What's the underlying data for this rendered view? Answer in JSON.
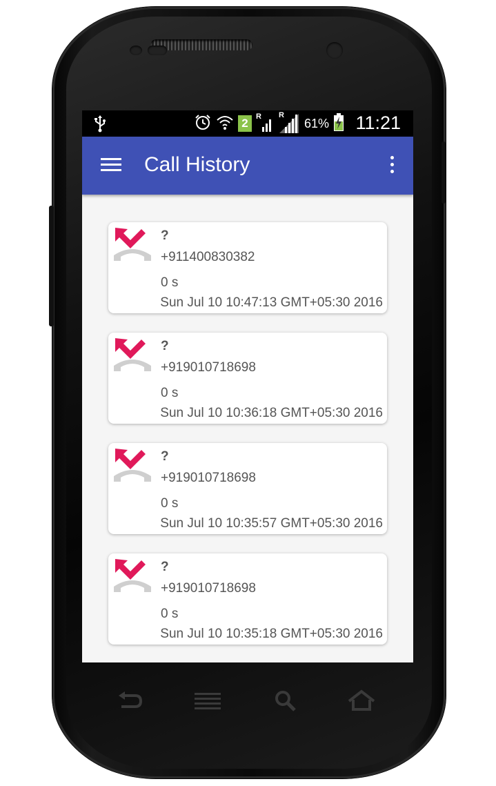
{
  "status_bar": {
    "usb_icon": "usb-icon",
    "alarm_icon": "alarm-clock-icon",
    "wifi_icon": "wifi-icon",
    "sim_badge": "2",
    "roaming_label": "R",
    "battery_percent": "61%",
    "time": "11:21"
  },
  "app_bar": {
    "title": "Call History",
    "menu_icon": "hamburger-menu-icon",
    "overflow_icon": "more-vert-icon",
    "color": "#3f51b5"
  },
  "calls": [
    {
      "name": "?",
      "number": "+911400830382",
      "duration": "0 s",
      "date": "Sun Jul 10 10:47:13 GMT+05:30 2016",
      "type": "missed"
    },
    {
      "name": "?",
      "number": "+919010718698",
      "duration": "0 s",
      "date": "Sun Jul 10 10:36:18 GMT+05:30 2016",
      "type": "missed"
    },
    {
      "name": "?",
      "number": "+919010718698",
      "duration": "0 s",
      "date": "Sun Jul 10 10:35:57 GMT+05:30 2016",
      "type": "missed"
    },
    {
      "name": "?",
      "number": "+919010718698",
      "duration": "0 s",
      "date": "Sun Jul 10 10:35:18 GMT+05:30 2016",
      "type": "missed"
    }
  ],
  "colors": {
    "missed_arrow": "#e0195a",
    "text": "#555555"
  },
  "nav_bar": [
    "back-icon",
    "menu-icon",
    "search-icon",
    "home-icon"
  ]
}
